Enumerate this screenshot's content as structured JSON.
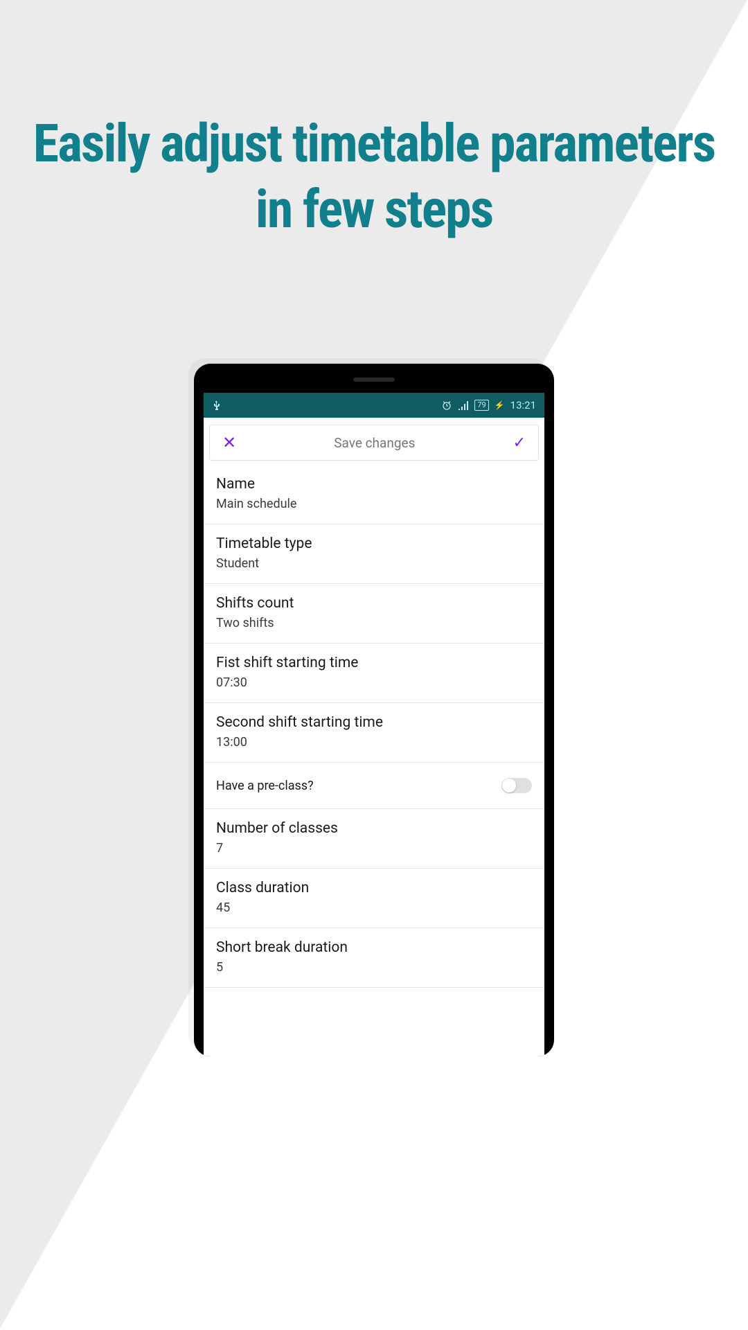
{
  "headline": {
    "line1": "Easily adjust timetable parameters",
    "line2": "in few steps"
  },
  "status": {
    "battery": "79",
    "time": "13:21"
  },
  "savebar": {
    "title": "Save changes"
  },
  "settings": {
    "name": {
      "label": "Name",
      "value": "Main schedule"
    },
    "type": {
      "label": "Timetable type",
      "value": "Student"
    },
    "shifts": {
      "label": "Shifts count",
      "value": "Two shifts"
    },
    "shift1": {
      "label": "Fist shift starting time",
      "value": "07:30"
    },
    "shift2": {
      "label": "Second shift starting time",
      "value": "13:00"
    },
    "preclass": {
      "label": "Have a pre-class?",
      "on": false
    },
    "num_classes": {
      "label": "Number of classes",
      "value": "7"
    },
    "class_duration": {
      "label": "Class duration",
      "value": "45"
    },
    "short_break": {
      "label": "Short break duration",
      "value": "5"
    }
  }
}
